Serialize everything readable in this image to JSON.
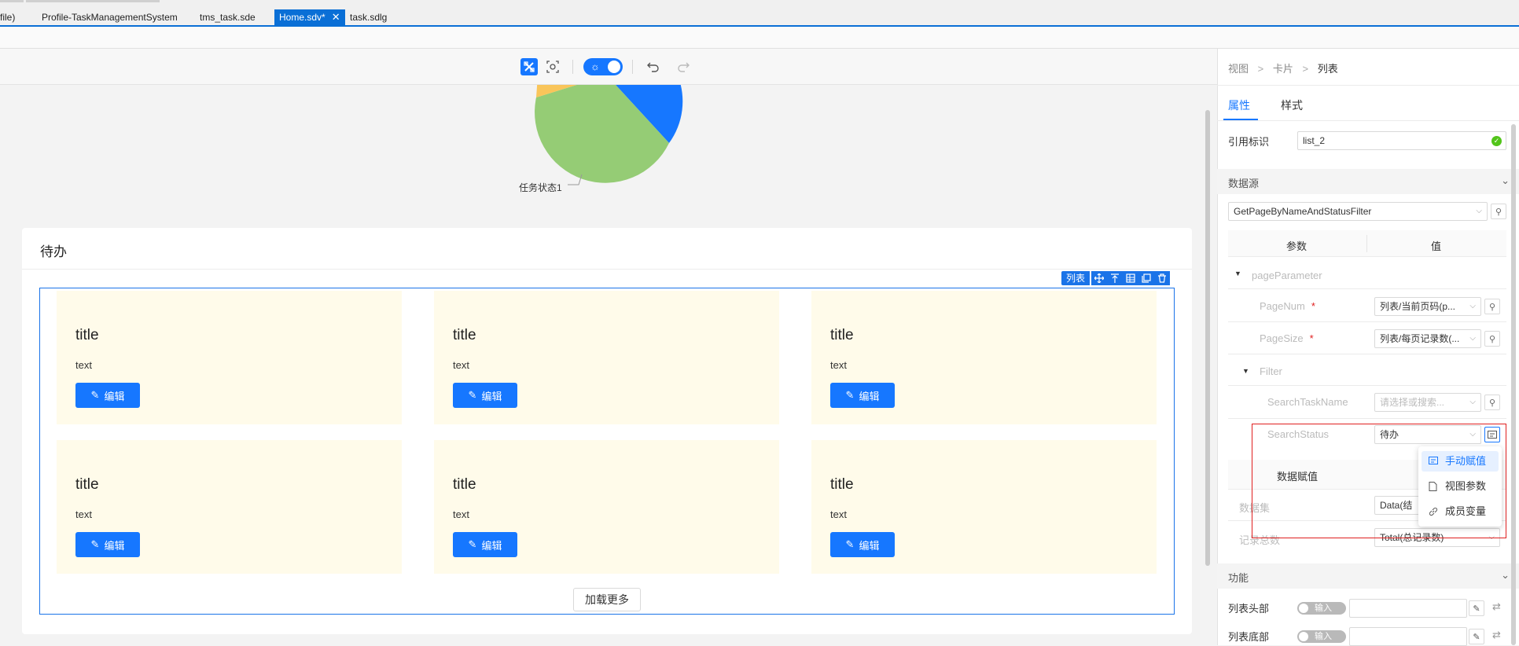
{
  "tabs": [
    {
      "label": "file)",
      "active": false
    },
    {
      "label": "Profile-TaskManagementSystem",
      "active": false
    },
    {
      "label": "tms_task.sde",
      "active": false
    },
    {
      "label": "Home.sdv*",
      "active": true
    },
    {
      "label": "task.sdlg",
      "active": false
    }
  ],
  "toolbar": {
    "design_icon": "design-mode-icon",
    "preview_icon": "preview-icon",
    "theme_icon": "sun-icon",
    "undo_icon": "undo-icon",
    "redo_icon": "redo-icon"
  },
  "chart": {
    "label": "任务状态1",
    "colors": {
      "blue": "#1677ff",
      "green": "#95cc75",
      "yellow": "#f9c55a"
    }
  },
  "todo": {
    "title": "待办",
    "list_tag": "列表",
    "items": [
      {
        "title": "title",
        "text": "text",
        "button": "编辑"
      },
      {
        "title": "title",
        "text": "text",
        "button": "编辑"
      },
      {
        "title": "title",
        "text": "text",
        "button": "编辑"
      },
      {
        "title": "title",
        "text": "text",
        "button": "编辑"
      },
      {
        "title": "title",
        "text": "text",
        "button": "编辑"
      },
      {
        "title": "title",
        "text": "text",
        "button": "编辑"
      }
    ],
    "load_more": "加载更多"
  },
  "panel": {
    "breadcrumb": [
      "视图",
      "卡片",
      "列表"
    ],
    "breadcrumb_sep": ">",
    "tabs": [
      {
        "label": "属性",
        "active": true
      },
      {
        "label": "样式",
        "active": false
      }
    ],
    "ref_id_label": "引用标识",
    "ref_id_value": "list_2",
    "datasource_label": "数据源",
    "datasource_value": "GetPageByNameAndStatusFilter",
    "param_header": "参数",
    "value_header": "值",
    "params": {
      "pageParameter": "pageParameter",
      "pageNum_label": "PageNum",
      "pageNum_value": "列表/当前页码(p...",
      "pageSize_label": "PageSize",
      "pageSize_value": "列表/每页记录数(...",
      "filter_label": "Filter",
      "searchTaskName_label": "SearchTaskName",
      "searchTaskName_placeholder": "请选择或搜索...",
      "searchStatus_label": "SearchStatus",
      "searchStatus_value": "待办",
      "required_mark": "*"
    },
    "assign_header": "数据赋值",
    "dataset_label": "数据集",
    "dataset_value": "Data(结",
    "total_label": "记录总数",
    "total_value": "Total(总记录数)",
    "dropdown": [
      "手动赋值",
      "视图参数",
      "成员变量"
    ],
    "function_label": "功能",
    "list_header_label": "列表头部",
    "list_footer_label": "列表底部",
    "toggle_label": "输入"
  },
  "colors": {
    "accent": "#1677ff",
    "tab_active": "#0a6fd6",
    "card_bg": "#fffbea",
    "highlight_red": "#e02020",
    "ok_green": "#52c41a"
  }
}
